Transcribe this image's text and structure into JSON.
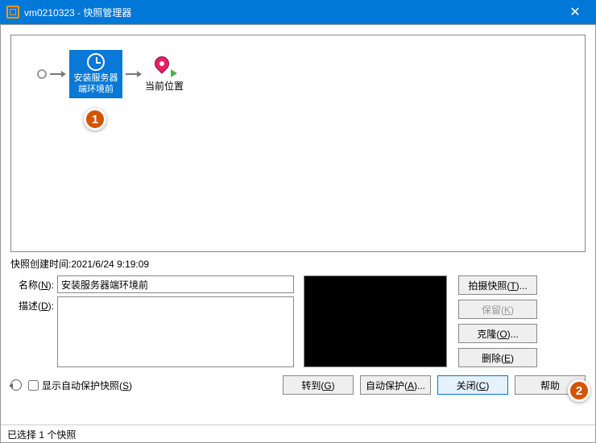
{
  "window": {
    "title": "vm0210323 - 快照管理器",
    "close": "✕"
  },
  "tree": {
    "selected_snapshot_line1": "安装服务器",
    "selected_snapshot_line2": "端环境前",
    "current": "当前位置"
  },
  "callouts": {
    "one": "1",
    "two": "2"
  },
  "info": {
    "created_label": "快照创建时间:",
    "created_value": "2021/6/24 9:19:09"
  },
  "form": {
    "name_label": "名称(",
    "name_key": "N",
    "name_label_end": "):",
    "name_value": "安装服务器端环境前",
    "desc_label": "描述(",
    "desc_key": "D",
    "desc_label_end": "):",
    "desc_value": ""
  },
  "right_buttons": {
    "take": "拍摄快照(",
    "take_key": "T",
    "take_end": ")...",
    "keep": "保留(",
    "keep_key": "K",
    "keep_end": ")",
    "clone": "克隆(",
    "clone_key": "O",
    "clone_end": ")...",
    "delete": "删除(",
    "delete_key": "E",
    "delete_end": ")"
  },
  "bottom": {
    "show_auto": "显示自动保护快照(",
    "show_auto_key": "S",
    "show_auto_end": ")",
    "goto": "转到(",
    "goto_key": "G",
    "goto_end": ")",
    "autoprotect": "自动保护(",
    "autoprotect_key": "A",
    "autoprotect_end": ")...",
    "close": "关闭(",
    "close_key": "C",
    "close_end": ")",
    "help": "帮助"
  },
  "status": "已选择 1 个快照"
}
